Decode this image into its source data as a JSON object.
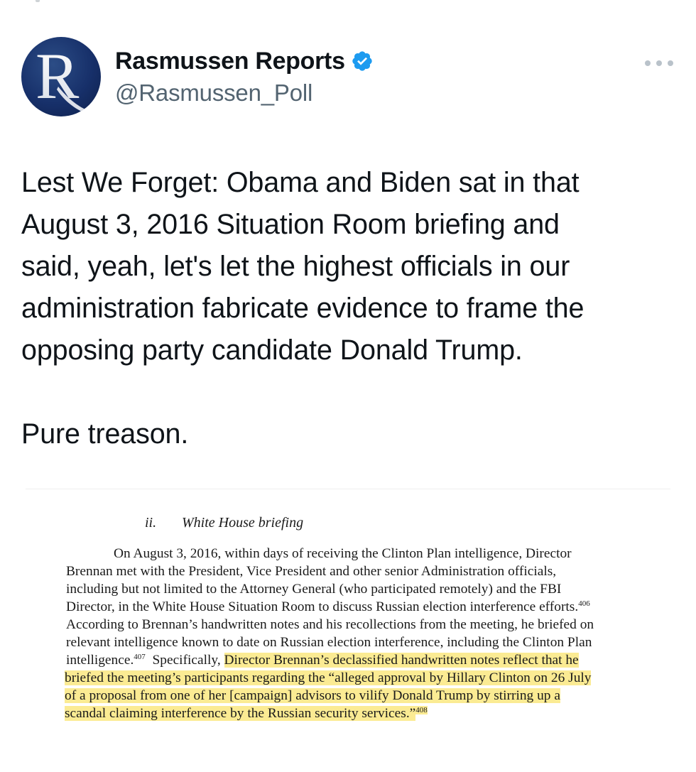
{
  "author": {
    "display_name": "Rasmussen Reports",
    "handle": "@Rasmussen_Poll",
    "avatar_letter": "R",
    "verified": true
  },
  "tweet": {
    "lines": [
      "Lest We Forget: Obama and Biden sat in that",
      "August 3, 2016 Situation Room briefing and",
      "said, yeah, let's let the highest officials in our",
      "administration fabricate evidence to frame the",
      "opposing party candidate Donald Trump."
    ],
    "closing": "Pure treason."
  },
  "document": {
    "heading_number": "ii.",
    "heading_title": "White House briefing",
    "lines": [
      {
        "text": "On August 3, 2016, within days of receiving the Clinton Plan intelligence, Director"
      },
      {
        "text": "Brennan met with the President, Vice President and other senior Administration officials,"
      },
      {
        "text": "including but not limited to the Attorney General (who participated remotely) and the FBI"
      },
      {
        "text": "Director, in the White House Situation Room to discuss Russian election interference efforts.",
        "sup": "406"
      },
      {
        "text": "According to Brennan’s handwritten notes and his recollections from the meeting, he briefed on"
      },
      {
        "text": "relevant intelligence known to date on Russian election interference, including the Clinton Plan"
      },
      {
        "pre": "intelligence.",
        "pre_sup": "407",
        "pre2": "  Specifically, ",
        "highlight": "Director Brennan’s declassified handwritten notes reflect that he"
      },
      {
        "highlight": "briefed the meeting’s participants regarding the “alleged approval by Hillary Clinton on 26 July"
      },
      {
        "highlight": "of a proposal from one of her [campaign] advisors to vilify Donald Trump by stirring up a"
      },
      {
        "highlight": "scandal claiming interference by the Russian security services.”",
        "sup": "408"
      }
    ]
  },
  "colors": {
    "text": "#0f1419",
    "secondary": "#536471",
    "verified_blue": "#1d9bf0",
    "highlight": "#fbeb93",
    "avatar_navy": "#17306a"
  }
}
